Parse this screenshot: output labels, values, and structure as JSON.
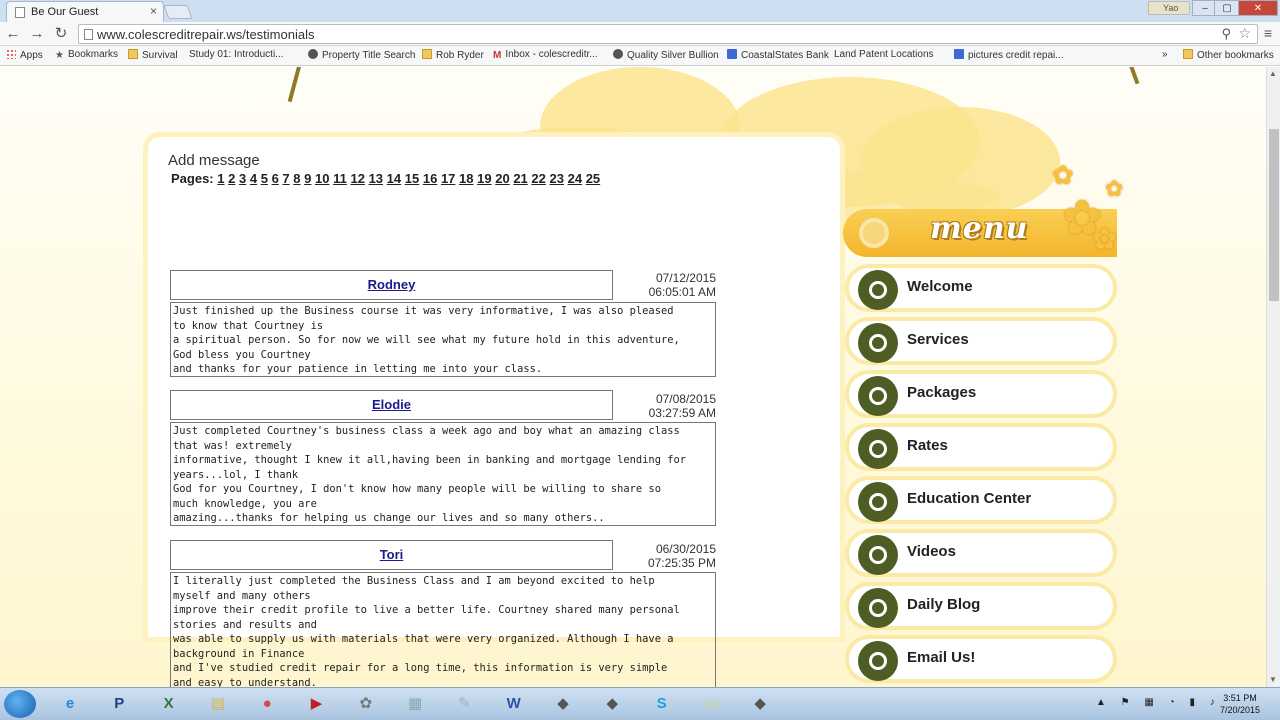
{
  "browser": {
    "tab_title": "Be Our Guest",
    "tab_close": "×",
    "profile_label": "Yao",
    "url": "www.colescreditrepair.ws/testimonials",
    "nav": {
      "back": "←",
      "forward": "→",
      "reload": "↻"
    },
    "zoom_icon": "magnifier",
    "window_controls": {
      "minimize": "–",
      "maximize": "▢",
      "close": "✕"
    },
    "bookmarks": [
      {
        "label": "Apps",
        "icon": "apps-grid"
      },
      {
        "label": "Bookmarks",
        "icon": "star"
      },
      {
        "label": "Survival",
        "icon": "folder"
      },
      {
        "label": "Study 01: Introducti...",
        "icon": "page"
      },
      {
        "label": "Property Title Search",
        "icon": "dark"
      },
      {
        "label": "Rob Ryder",
        "icon": "folder"
      },
      {
        "label": "Inbox - colescreditr...",
        "icon": "gmail"
      },
      {
        "label": "Quality Silver Bullion",
        "icon": "dark"
      },
      {
        "label": "CoastalStates Bank",
        "icon": "blue"
      },
      {
        "label": "Land Patent Locations",
        "icon": "page"
      },
      {
        "label": "pictures credit repai...",
        "icon": "blue"
      }
    ],
    "bookmarks_overflow": "»",
    "other_bookmarks": "Other bookmarks"
  },
  "guestbook": {
    "add_message": "Add message",
    "pages_label": "Pages:",
    "pages": [
      "1",
      "2",
      "3",
      "4",
      "5",
      "6",
      "7",
      "8",
      "9",
      "10",
      "11",
      "12",
      "13",
      "14",
      "15",
      "16",
      "17",
      "18",
      "19",
      "20",
      "21",
      "22",
      "23",
      "24",
      "25"
    ],
    "entries": [
      {
        "name": "Rodney",
        "date": "07/12/2015",
        "time": "06:05:01 AM",
        "message": "Just finished up the Business course it was very informative, I was also pleased\nto know that Courtney is\na spiritual person. So for now we will see what my future hold in this adventure,\nGod bless you Courtney\nand thanks for your patience in letting me into your class."
      },
      {
        "name": "Elodie",
        "date": "07/08/2015",
        "time": "03:27:59 AM",
        "message": "Just completed Courtney's business class a week ago and boy what an amazing class\nthat was! extremely\ninformative, thought I knew it all,having been in banking and mortgage lending for\nyears...lol, I thank\nGod for you Courtney, I don't know how many people will be willing to share so\nmuch knowledge, you are\namazing...thanks for helping us change our lives and so many others.."
      },
      {
        "name": "Tori",
        "date": "06/30/2015",
        "time": "07:25:35 PM",
        "message": "I literally just completed the Business Class and I am beyond excited to help\nmyself and many others\nimprove their credit profile to live a better life. Courtney shared many personal\nstories and results and\nwas able to supply us with materials that were very organized. Although I have a\nbackground in Finance\nand I've studied credit repair for a long time, this information is very simple\nand easy to understand."
      }
    ]
  },
  "menu": {
    "title": "menu",
    "items": [
      "Welcome",
      "Services",
      "Packages",
      "Rates",
      "Education Center",
      "Videos",
      "Daily Blog",
      "Email Us!"
    ]
  },
  "taskbar": {
    "apps": [
      "internet-explorer",
      "paypal",
      "excel",
      "file-explorer",
      "chrome",
      "youtube",
      "ccleaner",
      "calculator",
      "notepad",
      "word",
      "app",
      "app",
      "skype",
      "sticky-notes",
      "app"
    ],
    "clock_time": "3:51 PM",
    "clock_date": "7/20/2015"
  }
}
